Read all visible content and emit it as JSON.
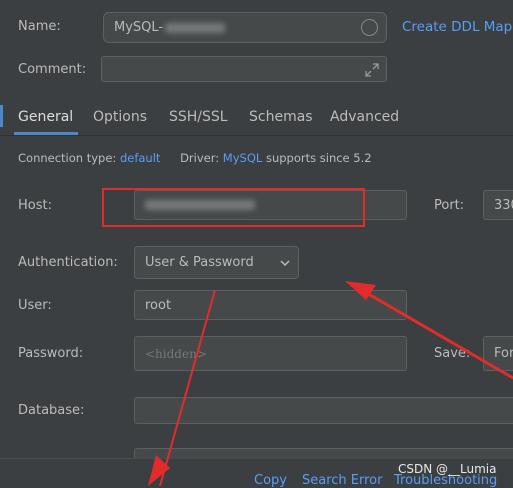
{
  "form": {
    "name_label": "Name:",
    "name_value": "MySQL-",
    "create_ddl_link": "Create DDL Mapp",
    "comment_label": "Comment:"
  },
  "tabs": [
    {
      "label": "General",
      "active": true
    },
    {
      "label": "Options"
    },
    {
      "label": "SSH/SSL"
    },
    {
      "label": "Schemas"
    },
    {
      "label": "Advanced"
    }
  ],
  "info": {
    "connection_type_label": "Connection type:",
    "connection_type_value": "default",
    "driver_label": "Driver:",
    "driver_value": "MySQL",
    "driver_suffix": "supports since 5.2"
  },
  "fields": {
    "host_label": "Host:",
    "port_label": "Port:",
    "port_value": "330",
    "auth_label": "Authentication:",
    "auth_value": "User & Password",
    "user_label": "User:",
    "user_value": "root",
    "password_label": "Password:",
    "password_placeholder": "<hidden>",
    "save_label": "Save:",
    "save_value": "For",
    "database_label": "Database:"
  },
  "footer": {
    "copy": "Copy",
    "search_error": "Search Error",
    "troubleshooting": "Troubleshooting",
    "watermark": "CSDN @__Lumia"
  },
  "colors": {
    "background": "#3c3f41",
    "link": "#589df6",
    "annotation": "#e22c2c"
  }
}
